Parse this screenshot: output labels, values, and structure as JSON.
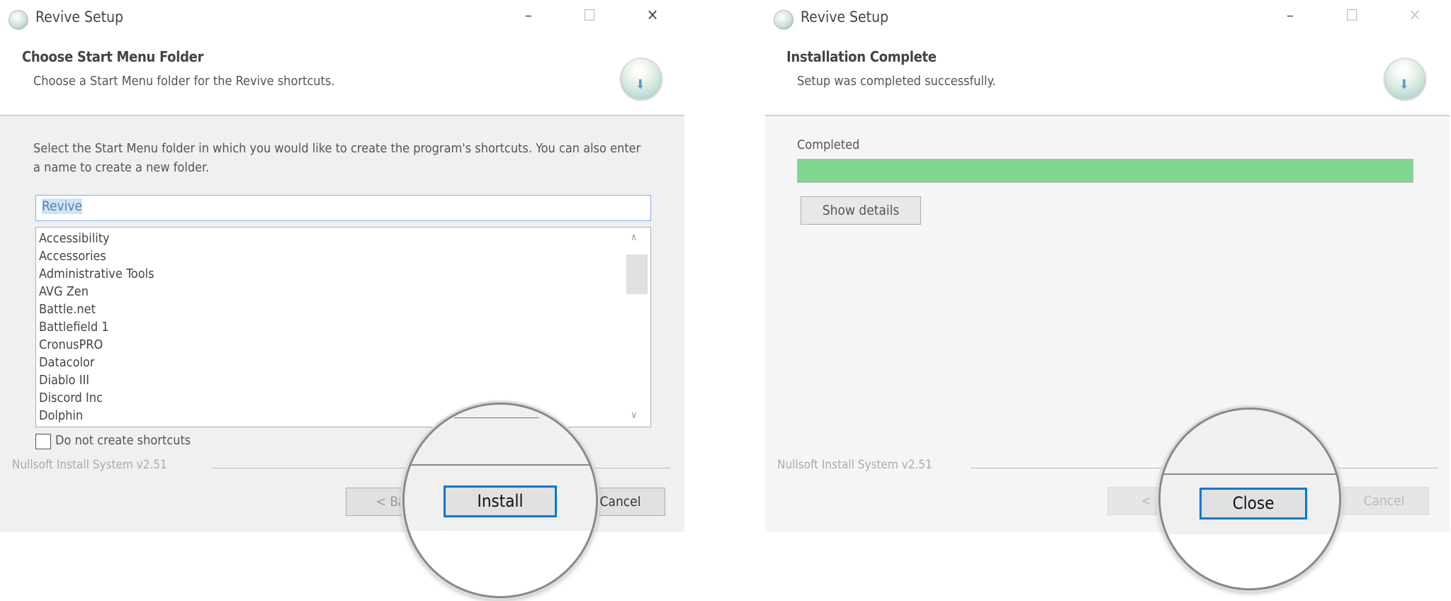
{
  "left": {
    "window_title": "Revive Setup",
    "header_title": "Choose Start Menu Folder",
    "header_subtitle": "Choose a Start Menu folder for the Revive shortcuts.",
    "description": "Select the Start Menu folder in which you would like to create the program's shortcuts. You can also enter a name to create a new folder.",
    "folder_input_value": "Revive",
    "folders": [
      "Accessibility",
      "Accessories",
      "Administrative Tools",
      "AVG Zen",
      "Battle.net",
      "Battlefield 1",
      "CronusPRO",
      "Datacolor",
      "Diablo III",
      "Discord Inc",
      "Dolphin"
    ],
    "checkbox_label": "Do not create shortcuts",
    "checkbox_checked": false,
    "branding": "Nullsoft Install System v2.51",
    "back_label": "< Back",
    "back_visible": "< Ba",
    "install_label": "Install",
    "cancel_label": "Cancel",
    "cancel_visible": "Cancel"
  },
  "right": {
    "window_title": "Revive Setup",
    "header_title": "Installation Complete",
    "header_subtitle": "Setup was completed successfully.",
    "progress_label": "Completed",
    "progress_percent": 100,
    "progress_color": "#7fd68f",
    "show_details_label": "Show details",
    "branding": "Nullsoft Install System v2.51",
    "back_visible": "< B",
    "close_label": "Close",
    "cancel_visible": "Cancel"
  },
  "colors": {
    "focus_border": "#0078d7",
    "selection": "#cce4f7"
  }
}
